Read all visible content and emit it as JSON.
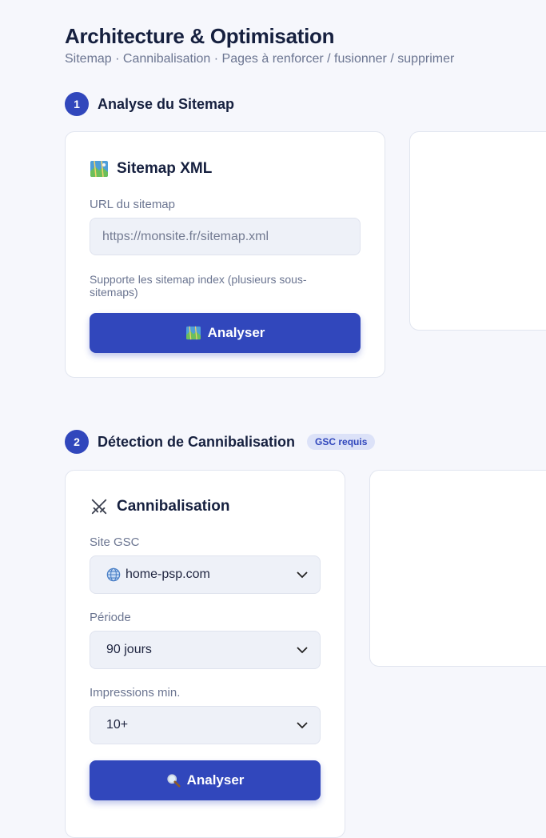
{
  "page": {
    "title": "Architecture & Optimisation",
    "subtitle": "Sitemap · Cannibalisation · Pages à renforcer / fusionner / supprimer"
  },
  "colors": {
    "accent": "#3147bc",
    "background": "#f6f7fc",
    "card": "#ffffff"
  },
  "section1": {
    "number": "1",
    "title": "Analyse du Sitemap",
    "card": {
      "icon": "map-icon",
      "title": "Sitemap XML",
      "url_label": "URL du sitemap",
      "url_placeholder": "https://monsite.fr/sitemap.xml",
      "url_value": "",
      "helper": "Supporte les sitemap index (plusieurs sous-sitemaps)",
      "button_icon": "map-icon",
      "button_label": "Analyser"
    }
  },
  "section2": {
    "number": "2",
    "title": "Détection de Cannibalisation",
    "badge": "GSC requis",
    "card": {
      "icon": "crossed-swords-icon",
      "title": "Cannibalisation",
      "site_label": "Site GSC",
      "site_icon": "globe-icon",
      "site_value": "home-psp.com",
      "period_label": "Période",
      "period_value": "90 jours",
      "impressions_label": "Impressions min.",
      "impressions_value": "10+",
      "button_icon": "magnifier-icon",
      "button_label": "Analyser"
    }
  }
}
